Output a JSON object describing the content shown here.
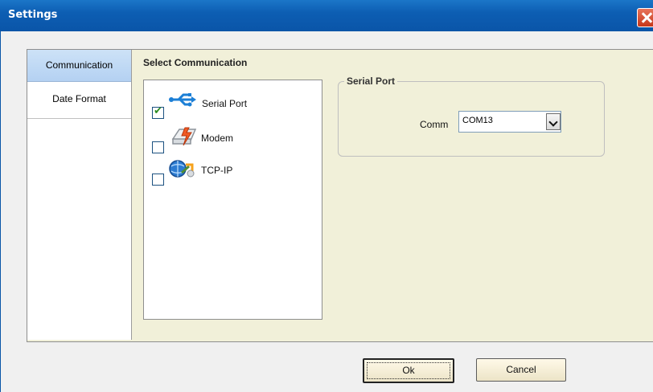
{
  "window": {
    "title": "Settings"
  },
  "tabs": [
    {
      "label": "Communication",
      "active": true
    },
    {
      "label": "Date Format",
      "active": false
    }
  ],
  "communication": {
    "title": "Select Communication",
    "options": [
      {
        "label": "Serial Port",
        "checked": true,
        "icon": "usb-icon"
      },
      {
        "label": "Modem",
        "checked": false,
        "icon": "modem-icon"
      },
      {
        "label": "TCP-IP",
        "checked": false,
        "icon": "network-icon"
      }
    ]
  },
  "serial_port": {
    "legend": "Serial Port",
    "comm_label": "Comm",
    "comm_value": "COM13"
  },
  "buttons": {
    "ok": "Ok",
    "cancel": "Cancel"
  },
  "colors": {
    "accent": "#0a55a8",
    "panel": "#f1f0d9",
    "tab_active": "#b4d1f2"
  }
}
